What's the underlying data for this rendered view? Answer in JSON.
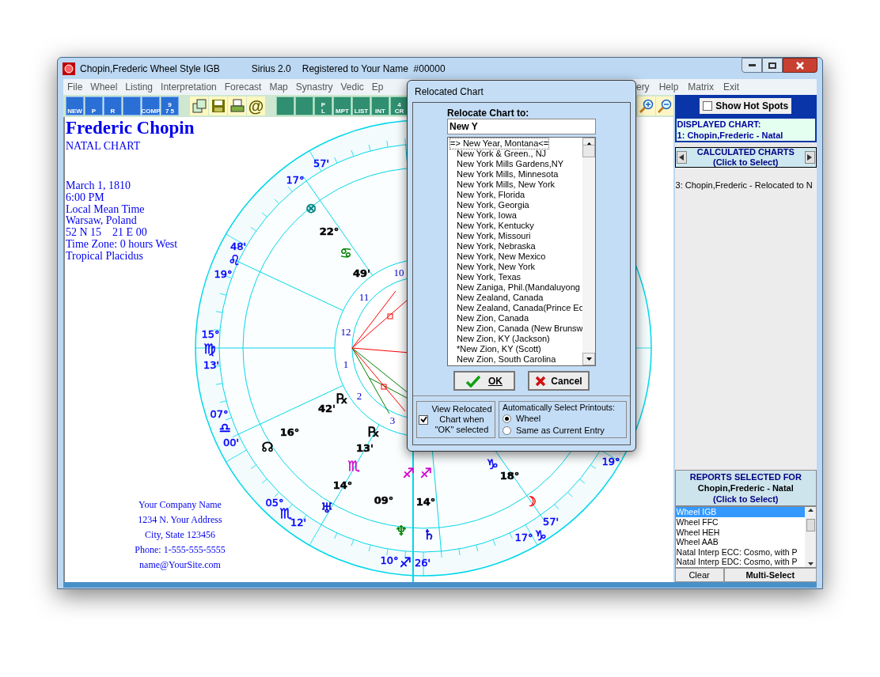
{
  "window": {
    "title": "Chopin,Frederic Wheel Style IGB",
    "version": "Sirius 2.0",
    "registration": "Registered to Your Name  #00000"
  },
  "menu_left": [
    "File",
    "Wheel",
    "Listing",
    "Interpretation",
    "Forecast",
    "Map",
    "Synastry",
    "Vedic",
    "Ep"
  ],
  "menu_right": [
    "ery",
    "Help",
    "Matrix",
    "Exit"
  ],
  "toolbar": [
    {
      "kind": "chart",
      "labels": [
        "NEW"
      ]
    },
    {
      "kind": "chart",
      "labels": [
        "P"
      ]
    },
    {
      "kind": "chart",
      "labels": [
        "R"
      ]
    },
    {
      "kind": "chart"
    },
    {
      "kind": "chart",
      "labels": [
        "COMP"
      ]
    },
    {
      "kind": "chart",
      "labels": [
        "9",
        "7 5"
      ]
    },
    {
      "kind": "gap"
    },
    {
      "kind": "windows"
    },
    {
      "kind": "save"
    },
    {
      "kind": "print"
    },
    {
      "kind": "at",
      "labels": [
        "@"
      ]
    },
    {
      "kind": "gap"
    },
    {
      "kind": "dark"
    },
    {
      "kind": "dark"
    },
    {
      "kind": "dark",
      "labels": [
        "P",
        "L"
      ]
    },
    {
      "kind": "dark",
      "labels": [
        "MPT"
      ]
    },
    {
      "kind": "dark",
      "labels": [
        "LIST"
      ]
    },
    {
      "kind": "dark",
      "labels": [
        "INT"
      ]
    },
    {
      "kind": "dark",
      "labels": [
        "4",
        "CR"
      ]
    }
  ],
  "zoom_tools": [
    {
      "kind": "zoom-in"
    },
    {
      "kind": "zoom-out"
    }
  ],
  "chart_header": {
    "name": "Frederic Chopin",
    "chart_type": "NATAL CHART",
    "details": [
      "March 1, 1810",
      "6:00 PM",
      "Local Mean Time",
      "Warsaw, Poland",
      "52 N 15    21 E 00",
      "Time Zone: 0 hours West",
      "Tropical Placidus"
    ]
  },
  "company": [
    "Your Company Name",
    "1234 N. Your Address",
    "City, State 123456",
    "Phone: 1-555-555-5555",
    "name@YourSite.com"
  ],
  "wheel": {
    "labels": [
      {
        "text": "57'",
        "color": "#0000ff"
      },
      {
        "text": "17°",
        "color": "#0000ff"
      },
      {
        "text": "⊗",
        "color": "#008080"
      },
      {
        "text": "22°",
        "color": "#000000"
      },
      {
        "text": "♋",
        "color": "#008000"
      },
      {
        "text": "49'",
        "color": "#000000"
      },
      {
        "text": "48'",
        "color": "#0000ff"
      },
      {
        "text": "♌",
        "color": "#0000ff"
      },
      {
        "text": "19°",
        "color": "#0000ff"
      },
      {
        "text": "15°",
        "color": "#0000ff"
      },
      {
        "text": "♍",
        "color": "#0000ff"
      },
      {
        "text": "13'",
        "color": "#0000ff"
      },
      {
        "text": "07°",
        "color": "#0000ff"
      },
      {
        "text": "♎",
        "color": "#0000ff"
      },
      {
        "text": "00'",
        "color": "#0000ff"
      },
      {
        "text": "☊",
        "color": "#000000"
      },
      {
        "text": "16°",
        "color": "#000000"
      },
      {
        "text": "42'",
        "color": "#000000"
      },
      {
        "text": "℞",
        "color": "#000000"
      },
      {
        "text": "℞",
        "color": "#000000"
      },
      {
        "text": "13'",
        "color": "#000000"
      },
      {
        "text": "♏",
        "color": "#cc00cc"
      },
      {
        "text": "14°",
        "color": "#000000"
      },
      {
        "text": "♅",
        "color": "#0000cc"
      },
      {
        "text": "09°",
        "color": "#000000"
      },
      {
        "text": "14°",
        "color": "#000000"
      },
      {
        "text": "♐",
        "color": "#cc00cc"
      },
      {
        "text": "♐",
        "color": "#cc00cc"
      },
      {
        "text": "♆",
        "color": "#008000"
      },
      {
        "text": "♄",
        "color": "#0000cc"
      },
      {
        "text": "05°",
        "color": "#0000ff"
      },
      {
        "text": "♏",
        "color": "#0000ff"
      },
      {
        "text": "12'",
        "color": "#0000ff"
      },
      {
        "text": "10°",
        "color": "#0000ff"
      },
      {
        "text": "♐",
        "color": "#0000ff"
      },
      {
        "text": "26'",
        "color": "#0000ff"
      },
      {
        "text": "18°",
        "color": "#000000"
      },
      {
        "text": "☽",
        "color": "#ff0000"
      },
      {
        "text": "57'",
        "color": "#0000ff"
      },
      {
        "text": "17°",
        "color": "#0000ff"
      },
      {
        "text": "♑",
        "color": "#0000ff"
      },
      {
        "text": "♑",
        "color": "#0000ff"
      },
      {
        "text": "19°",
        "color": "#0000ff"
      }
    ],
    "house_numbers": [
      "10",
      "11",
      "12",
      "1",
      "2",
      "3"
    ]
  },
  "side_panel": {
    "hot_spots": {
      "label": "Show Hot Spots",
      "checked": false
    },
    "displayed_title": "DISPLAYED CHART:",
    "displayed_chart": "1: Chopin,Frederic - Natal",
    "calculated_title": "CALCULATED CHARTS",
    "calculated_hint": "(Click to Select)",
    "calculated_items": [
      "3: Chopin,Frederic - Relocated to N"
    ],
    "reports_title": "REPORTS SELECTED FOR",
    "reports_chart": "Chopin,Frederic - Natal",
    "reports_hint": "(Click to Select)",
    "reports": [
      {
        "label": "Wheel IGB",
        "selected": true
      },
      {
        "label": "Wheel FFC",
        "selected": false
      },
      {
        "label": "Wheel HEH",
        "selected": false
      },
      {
        "label": "Wheel AAB",
        "selected": false
      },
      {
        "label": "Natal Interp ECC: Cosmo, with P",
        "selected": false
      },
      {
        "label": "Natal Interp EDC: Cosmo, with P",
        "selected": false
      }
    ],
    "buttons": [
      "Clear",
      "Multi-Select"
    ]
  },
  "dialog": {
    "title": "Relocated Chart",
    "field_label": "Relocate Chart to:",
    "value": "New Y",
    "items": [
      {
        "label": "=> New Year, Montana<=",
        "current": true
      },
      {
        "label": "New York & Green., NJ",
        "current": false
      },
      {
        "label": "New York Mills Gardens,NY",
        "current": false
      },
      {
        "label": "New York Mills, Minnesota",
        "current": false
      },
      {
        "label": "New York Mills, New York",
        "current": false
      },
      {
        "label": "New York, Florida",
        "current": false
      },
      {
        "label": "New York, Georgia",
        "current": false
      },
      {
        "label": "New York, Iowa",
        "current": false
      },
      {
        "label": "New York, Kentucky",
        "current": false
      },
      {
        "label": "New York, Missouri",
        "current": false
      },
      {
        "label": "New York, Nebraska",
        "current": false
      },
      {
        "label": "New York, New Mexico",
        "current": false
      },
      {
        "label": "New York, New York",
        "current": false
      },
      {
        "label": "New York, Texas",
        "current": false
      },
      {
        "label": "New Zaniga, Phil.(Mandaluyong",
        "current": false
      },
      {
        "label": "New Zealand, Canada",
        "current": false
      },
      {
        "label": "New Zealand, Canada(Prince Ed",
        "current": false
      },
      {
        "label": "New Zion, Canada",
        "current": false
      },
      {
        "label": "New Zion, Canada (New Brunsw",
        "current": false
      },
      {
        "label": "New Zion, KY (Jackson)",
        "current": false
      },
      {
        "label": "*New Zion, KY (Scott)",
        "current": false
      },
      {
        "label": "New Zion, South Carolina",
        "current": false
      }
    ],
    "ok": "OK",
    "cancel": "Cancel",
    "view_option": {
      "label": "View Relocated Chart when \"OK\" selected",
      "checked": true
    },
    "printouts_title": "Automatically Select Printouts:",
    "printouts": [
      {
        "label": "Wheel",
        "selected": true
      },
      {
        "label": "Same as Current Entry",
        "selected": false
      }
    ]
  }
}
